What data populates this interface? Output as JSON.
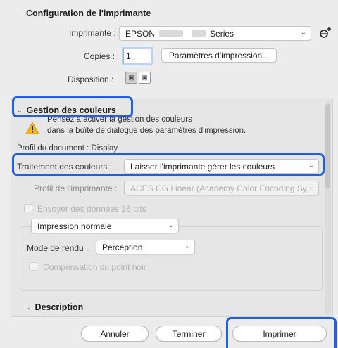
{
  "printer_config": {
    "title": "Configuration de l'imprimante",
    "printer_label": "Imprimante :",
    "printer_value_prefix": "EPSON",
    "printer_value_suffix": "Series",
    "copies_label": "Copies :",
    "copies_value": "1",
    "print_settings_button": "Paramètres d'impression...",
    "layout_label": "Disposition :"
  },
  "color_management": {
    "title": "Gestion des couleurs",
    "warning_line1": "Pensez à activer la gestion des couleurs",
    "warning_line2": "dans la boîte de dialogue des paramètres d'impression.",
    "document_profile": "Profil du document : Display",
    "color_handling_label": "Traitement des couleurs :",
    "color_handling_value": "Laisser l'imprimante gérer les couleurs",
    "printer_profile_label": "Profil de l'imprimante :",
    "printer_profile_value": "ACES CG Linear (Academy Color Encoding Sy...",
    "send_16bit_label": "Envoyer des données 16 bits",
    "print_mode_value": "Impression normale",
    "rendering_label": "Mode de rendu :",
    "rendering_value": "Perception",
    "black_point_label": "Compensation du point noir"
  },
  "description": {
    "title": "Description"
  },
  "footer": {
    "cancel": "Annuler",
    "done": "Terminer",
    "print": "Imprimer"
  },
  "colors": {
    "highlight": "#1d5fe6",
    "warning": "#f2b619"
  }
}
